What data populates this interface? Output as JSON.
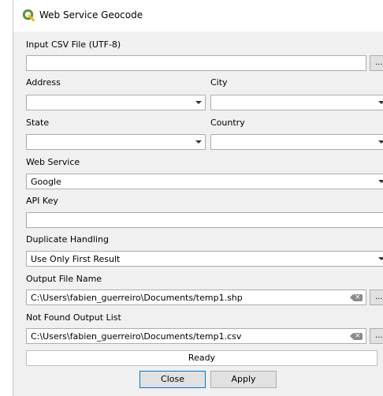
{
  "window": {
    "title": "Web Service Geocode"
  },
  "form": {
    "input_csv_label": "Input CSV File (UTF-8)",
    "input_csv_value": "",
    "browse_label": "...",
    "address_label": "Address",
    "address_value": "",
    "city_label": "City",
    "city_value": "",
    "state_label": "State",
    "state_value": "",
    "country_label": "Country",
    "country_value": "",
    "web_service_label": "Web Service",
    "web_service_value": "Google",
    "api_key_label": "API Key",
    "api_key_value": "",
    "duplicate_label": "Duplicate Handling",
    "duplicate_value": "Use Only First Result",
    "output_file_label": "Output File Name",
    "output_file_value": "C:\\Users\\fabien_guerreiro\\Documents/temp1.shp",
    "not_found_label": "Not Found Output List",
    "not_found_value": "C:\\Users\\fabien_guerreiro\\Documents/temp1.csv"
  },
  "status": {
    "text": "Ready"
  },
  "buttons": {
    "close": "Close",
    "apply": "Apply"
  },
  "colors": {
    "qgis_green": "#589632",
    "default_button_border": "#0078d7"
  }
}
